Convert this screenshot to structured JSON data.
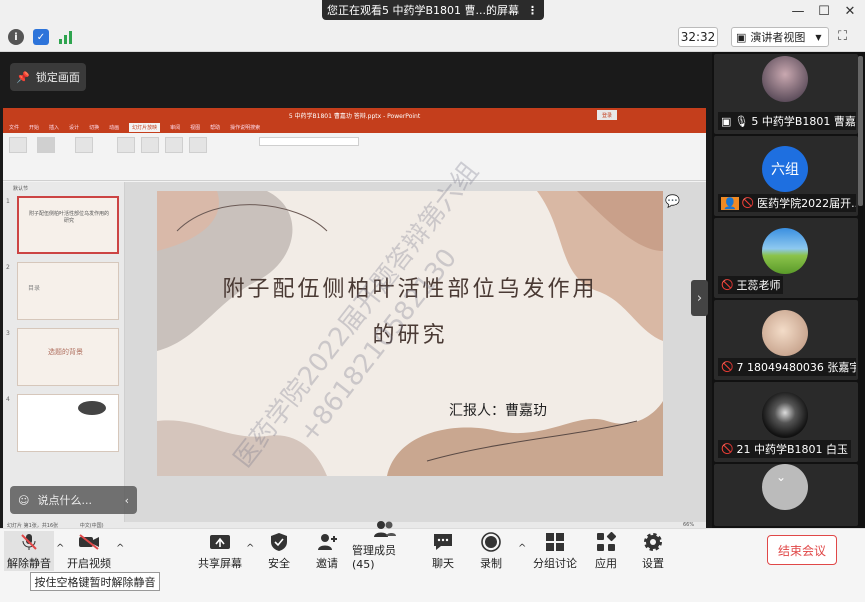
{
  "window": {
    "share_banner": "您正在观看5 中药学B1801 曹...的屏幕",
    "share_options": "⋮",
    "minimize": "—",
    "maximize": "☐",
    "close": "✕"
  },
  "topbar": {
    "timer": "32:32",
    "view_label": "演讲者视图"
  },
  "stage": {
    "lock_label": "锁定画面",
    "say_placeholder": "说点什么...",
    "watermark_line1": "医药学院2022届开题答辩第六组",
    "watermark_line2": "+8618210582130"
  },
  "ppt": {
    "title": "5 中药学B1801 曹嘉玏  答辩.pptx - PowerPoint",
    "signin": "登录",
    "tabs": [
      "文件",
      "开始",
      "插入",
      "设计",
      "切换",
      "动画",
      "幻灯片放映",
      "审阅",
      "视图",
      "帮助",
      "操作说明搜索"
    ],
    "active_tab": "幻灯片放映",
    "section_label": "默认节",
    "status_left": "幻灯片 第1张，共16张",
    "status_lang": "中文(中国)",
    "zoom": "66%",
    "slide": {
      "title": "附子配伍侧柏叶活性部位乌发作用的研究",
      "presenter": "汇报人：曹嘉玏"
    },
    "thumbs": [
      {
        "num": "1",
        "text": "附子配伍侧柏叶活性部位乌发作用的研究"
      },
      {
        "num": "2",
        "text": "目录"
      },
      {
        "num": "3",
        "text": "选题的背景"
      },
      {
        "num": "4",
        "text": ""
      }
    ]
  },
  "participants": [
    {
      "name": "5 中药学B1801 曹嘉..."
    },
    {
      "name": "医药学院2022届开...",
      "avatar_text": "六组"
    },
    {
      "name": "王蕊老师"
    },
    {
      "name": "7 18049480036  张嘉宇"
    },
    {
      "name": "21 中药学B1801 白玉"
    }
  ],
  "toolbar": {
    "mute": "解除静音",
    "video": "开启视频",
    "share": "共享屏幕",
    "security": "安全",
    "invite": "邀请",
    "manage": "管理成员(45)",
    "chat": "聊天",
    "record": "录制",
    "breakout": "分组讨论",
    "apps": "应用",
    "settings": "设置",
    "end": "结束会议",
    "tooltip": "按住空格键暂时解除静音"
  },
  "colors": {
    "accent_red": "#e04848",
    "ppt_red": "#c43e1c",
    "six_group_blue": "#1e6fe0"
  }
}
